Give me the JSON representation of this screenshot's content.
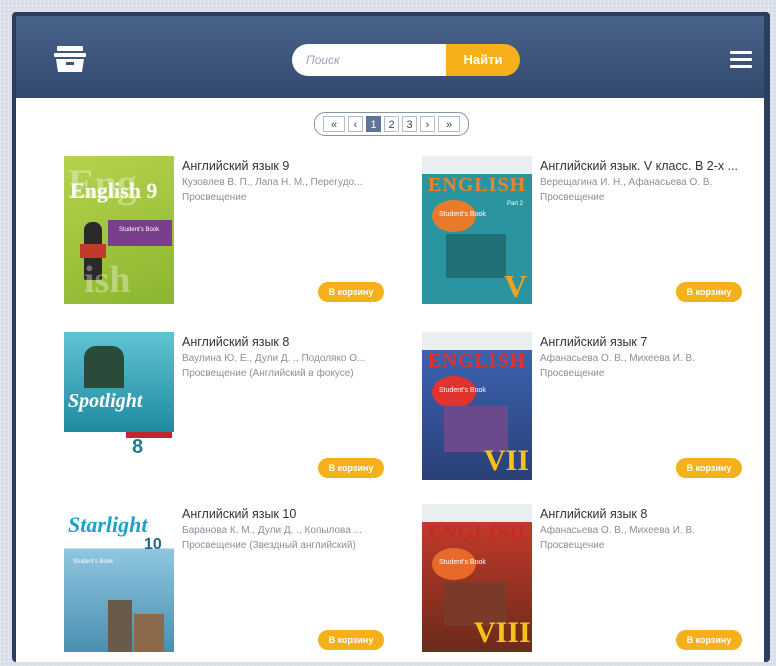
{
  "header": {
    "search_placeholder": "Поиск",
    "search_button": "Найти"
  },
  "pagination": {
    "items": [
      "«",
      "‹",
      "1",
      "2",
      "3",
      "›",
      "»"
    ],
    "active": "1"
  },
  "books": [
    {
      "title": "Английский язык 9",
      "authors": "Кузовлев В. П., Лапа Н. М., Перегудо...",
      "publisher": "Просвещение",
      "button": "В корзину",
      "cover_text": "English 9",
      "cover_badge": "Student's Book"
    },
    {
      "title": "Английский язык. V класс. В 2-х ...",
      "authors": "Верещагина И. Н., Афанасьева О. В.",
      "publisher": "Просвещение",
      "button": "В корзину",
      "cover_text": "ENGLISH",
      "cover_badge": "Student's Book",
      "cover_part": "Part 2",
      "cover_numeral": "V"
    },
    {
      "title": "Английский язык 8",
      "authors": "Ваулина Ю. Е., Дули Д. ., Подоляко О...",
      "publisher": "Просвещение (Английский в фокусе)",
      "button": "В корзину",
      "cover_text": "Spotlight",
      "cover_numeral": "8"
    },
    {
      "title": "Английский язык 7",
      "authors": "Афанасьева О. В., Михеева И. В.",
      "publisher": "Просвещение",
      "button": "В корзину",
      "cover_text": "ENGLISH",
      "cover_badge": "Student's Book",
      "cover_numeral": "VII"
    },
    {
      "title": "Английский язык 10",
      "authors": "Баранова К. М., Дули Д. ., Копылова ...",
      "publisher": "Просвещение (Звездный английский)",
      "button": "В корзину",
      "cover_text": "Starlight",
      "cover_numeral": "10",
      "cover_badge": "Student's Book"
    },
    {
      "title": "Английский язык 8",
      "authors": "Афанасьева О. В., Михеева И. В.",
      "publisher": "Просвещение",
      "button": "В корзину",
      "cover_text": "ENGLISH",
      "cover_badge": "Student's Book",
      "cover_numeral": "VIII"
    }
  ],
  "colors": {
    "header_top": "#4a638a",
    "header_bottom": "#33496e",
    "accent": "#f5b01a",
    "pager_active": "#5d7598"
  },
  "icons": {
    "cart": "basket-icon",
    "menu": "hamburger-menu-icon"
  }
}
